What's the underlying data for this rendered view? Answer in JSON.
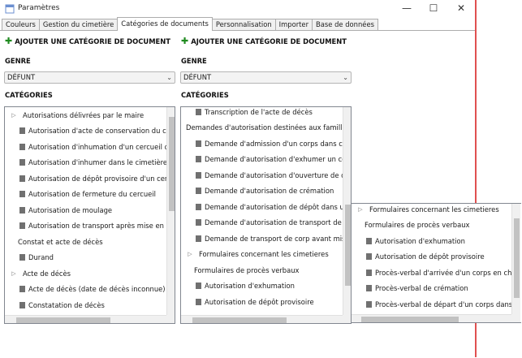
{
  "window": {
    "title": "Paramètres",
    "minimize": "—",
    "maximize": "☐",
    "close": "✕"
  },
  "tabs": [
    {
      "label": "Couleurs"
    },
    {
      "label": "Gestion du cimetière"
    },
    {
      "label": "Catégories de documents",
      "active": true
    },
    {
      "label": "Personnalisation"
    },
    {
      "label": "Importer"
    },
    {
      "label": "Base de données"
    }
  ],
  "panel_common": {
    "add_label": "AJOUTER UNE CATÉGORIE DE DOCUMENT",
    "genre_label": "GENRE",
    "genre_value": "DÉFUNT",
    "categories_label": "CATÉGORIES"
  },
  "tree1": [
    {
      "label": "Autorisations délivrées par le maire",
      "kind": "folder",
      "level": 0
    },
    {
      "label": "Autorisation d'acte de conservation du corps",
      "kind": "doc",
      "level": 1
    },
    {
      "label": "Autorisation d'inhumation d'un cercueil dans",
      "kind": "doc",
      "level": 1
    },
    {
      "label": "Autorisation d'inhumer dans le cimetière com",
      "kind": "doc",
      "level": 1
    },
    {
      "label": "Autorisation de dépôt provisoire d'un cercueil",
      "kind": "doc",
      "level": 1
    },
    {
      "label": "Autorisation de fermeture du cercueil",
      "kind": "doc",
      "level": 1
    },
    {
      "label": "Autorisation de moulage",
      "kind": "doc",
      "level": 1
    },
    {
      "label": "Autorisation de transport après mise en cercu",
      "kind": "doc",
      "level": 1
    },
    {
      "label": "Constat et acte de décès",
      "kind": "group",
      "level": 0
    },
    {
      "label": "Durand",
      "kind": "doc",
      "level": 1
    },
    {
      "label": "Acte de décès",
      "kind": "folder",
      "level": 0
    },
    {
      "label": "Acte de décès (date de décès inconnue)",
      "kind": "doc",
      "level": 1
    },
    {
      "label": "Constatation de décès",
      "kind": "doc",
      "level": 1
    }
  ],
  "tree2": [
    {
      "label": "Transcription de l'acte de décès",
      "kind": "doc",
      "level": 1
    },
    {
      "label": "Demandes d'autorisation destinées aux familles",
      "kind": "group",
      "level": 0
    },
    {
      "label": "Demande d'admission d'un corps dans chambre",
      "kind": "doc",
      "level": 1
    },
    {
      "label": "Demande d'autorisation d'exhumer un corps",
      "kind": "doc",
      "level": 1
    },
    {
      "label": "Demande d'autorisation d'ouverture de corps",
      "kind": "doc",
      "level": 1
    },
    {
      "label": "Demande d'autorisation de crémation",
      "kind": "doc",
      "level": 1
    },
    {
      "label": "Demande d'autorisation de dépôt dans un lieu",
      "kind": "doc",
      "level": 1
    },
    {
      "label": "Demande d'autorisation de transport de corps",
      "kind": "doc",
      "level": 1
    },
    {
      "label": "Demande de transport de corp avant mise en bière",
      "kind": "doc",
      "level": 1
    },
    {
      "label": "Formulaires concernant les cimetieres",
      "kind": "folder",
      "level": 0
    },
    {
      "label": "Formulaires de procès verbaux",
      "kind": "group",
      "level": 0
    },
    {
      "label": "Autorisation d'exhumation",
      "kind": "doc",
      "level": 1
    },
    {
      "label": "Autorisation de dépôt provisoire",
      "kind": "doc",
      "level": 1
    }
  ],
  "tree3": [
    {
      "label": "Formulaires concernant les cimetieres",
      "kind": "folder",
      "level": 0
    },
    {
      "label": "Formulaires de procès verbaux",
      "kind": "group",
      "level": 0
    },
    {
      "label": "Autorisation d'exhumation",
      "kind": "doc",
      "level": 1
    },
    {
      "label": "Autorisation de dépôt provisoire",
      "kind": "doc",
      "level": 1
    },
    {
      "label": "Procès-verbal d'arrivée d'un corps en chambre funéraire",
      "kind": "doc",
      "level": 1
    },
    {
      "label": "Procès-verbal de crémation",
      "kind": "doc",
      "level": 1
    },
    {
      "label": "Procès-verbal de départ d'un corps dans une",
      "kind": "doc",
      "level": 1
    }
  ]
}
